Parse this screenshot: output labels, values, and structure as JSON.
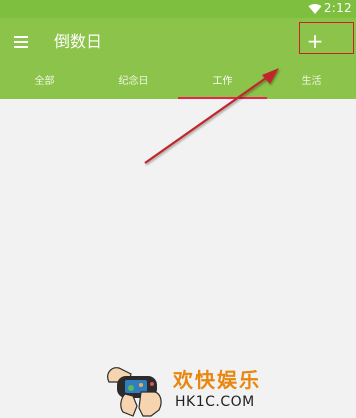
{
  "status_bar": {
    "time": "2:12",
    "wifi_icon": "wifi-icon"
  },
  "toolbar": {
    "menu_icon": "menu-icon",
    "title": "倒数日",
    "add_icon": "plus-icon",
    "add_label": "+"
  },
  "tabs": [
    {
      "label": "全部",
      "selected": false
    },
    {
      "label": "纪念日",
      "selected": false
    },
    {
      "label": "工作",
      "selected": true
    },
    {
      "label": "生活",
      "selected": false
    }
  ],
  "colors": {
    "status_bar": "#7fbf3f",
    "toolbar": "#8cc34a",
    "tab_indicator": "#e6274a",
    "annotation": "#cc2222",
    "content_bg": "#f2f2f2"
  },
  "watermark": {
    "title": "欢快娱乐",
    "domain": "HK1C.COM"
  }
}
